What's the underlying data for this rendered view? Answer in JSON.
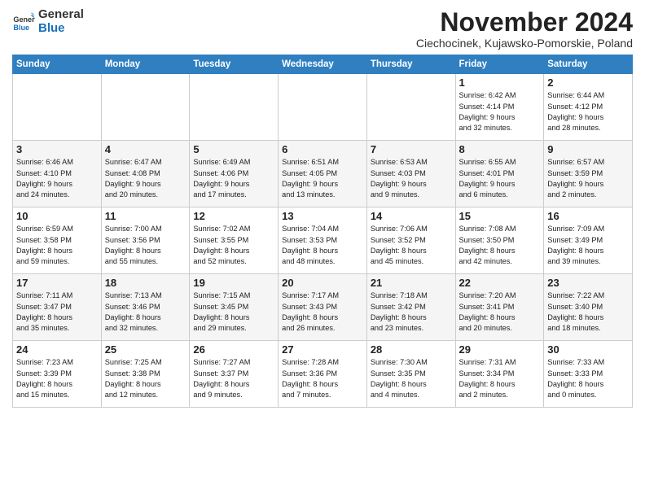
{
  "logo": {
    "line1": "General",
    "line2": "Blue"
  },
  "title": "November 2024",
  "location": "Ciechocinek, Kujawsko-Pomorskie, Poland",
  "headers": [
    "Sunday",
    "Monday",
    "Tuesday",
    "Wednesday",
    "Thursday",
    "Friday",
    "Saturday"
  ],
  "weeks": [
    [
      {
        "day": "",
        "info": ""
      },
      {
        "day": "",
        "info": ""
      },
      {
        "day": "",
        "info": ""
      },
      {
        "day": "",
        "info": ""
      },
      {
        "day": "",
        "info": ""
      },
      {
        "day": "1",
        "info": "Sunrise: 6:42 AM\nSunset: 4:14 PM\nDaylight: 9 hours\nand 32 minutes."
      },
      {
        "day": "2",
        "info": "Sunrise: 6:44 AM\nSunset: 4:12 PM\nDaylight: 9 hours\nand 28 minutes."
      }
    ],
    [
      {
        "day": "3",
        "info": "Sunrise: 6:46 AM\nSunset: 4:10 PM\nDaylight: 9 hours\nand 24 minutes."
      },
      {
        "day": "4",
        "info": "Sunrise: 6:47 AM\nSunset: 4:08 PM\nDaylight: 9 hours\nand 20 minutes."
      },
      {
        "day": "5",
        "info": "Sunrise: 6:49 AM\nSunset: 4:06 PM\nDaylight: 9 hours\nand 17 minutes."
      },
      {
        "day": "6",
        "info": "Sunrise: 6:51 AM\nSunset: 4:05 PM\nDaylight: 9 hours\nand 13 minutes."
      },
      {
        "day": "7",
        "info": "Sunrise: 6:53 AM\nSunset: 4:03 PM\nDaylight: 9 hours\nand 9 minutes."
      },
      {
        "day": "8",
        "info": "Sunrise: 6:55 AM\nSunset: 4:01 PM\nDaylight: 9 hours\nand 6 minutes."
      },
      {
        "day": "9",
        "info": "Sunrise: 6:57 AM\nSunset: 3:59 PM\nDaylight: 9 hours\nand 2 minutes."
      }
    ],
    [
      {
        "day": "10",
        "info": "Sunrise: 6:59 AM\nSunset: 3:58 PM\nDaylight: 8 hours\nand 59 minutes."
      },
      {
        "day": "11",
        "info": "Sunrise: 7:00 AM\nSunset: 3:56 PM\nDaylight: 8 hours\nand 55 minutes."
      },
      {
        "day": "12",
        "info": "Sunrise: 7:02 AM\nSunset: 3:55 PM\nDaylight: 8 hours\nand 52 minutes."
      },
      {
        "day": "13",
        "info": "Sunrise: 7:04 AM\nSunset: 3:53 PM\nDaylight: 8 hours\nand 48 minutes."
      },
      {
        "day": "14",
        "info": "Sunrise: 7:06 AM\nSunset: 3:52 PM\nDaylight: 8 hours\nand 45 minutes."
      },
      {
        "day": "15",
        "info": "Sunrise: 7:08 AM\nSunset: 3:50 PM\nDaylight: 8 hours\nand 42 minutes."
      },
      {
        "day": "16",
        "info": "Sunrise: 7:09 AM\nSunset: 3:49 PM\nDaylight: 8 hours\nand 39 minutes."
      }
    ],
    [
      {
        "day": "17",
        "info": "Sunrise: 7:11 AM\nSunset: 3:47 PM\nDaylight: 8 hours\nand 35 minutes."
      },
      {
        "day": "18",
        "info": "Sunrise: 7:13 AM\nSunset: 3:46 PM\nDaylight: 8 hours\nand 32 minutes."
      },
      {
        "day": "19",
        "info": "Sunrise: 7:15 AM\nSunset: 3:45 PM\nDaylight: 8 hours\nand 29 minutes."
      },
      {
        "day": "20",
        "info": "Sunrise: 7:17 AM\nSunset: 3:43 PM\nDaylight: 8 hours\nand 26 minutes."
      },
      {
        "day": "21",
        "info": "Sunrise: 7:18 AM\nSunset: 3:42 PM\nDaylight: 8 hours\nand 23 minutes."
      },
      {
        "day": "22",
        "info": "Sunrise: 7:20 AM\nSunset: 3:41 PM\nDaylight: 8 hours\nand 20 minutes."
      },
      {
        "day": "23",
        "info": "Sunrise: 7:22 AM\nSunset: 3:40 PM\nDaylight: 8 hours\nand 18 minutes."
      }
    ],
    [
      {
        "day": "24",
        "info": "Sunrise: 7:23 AM\nSunset: 3:39 PM\nDaylight: 8 hours\nand 15 minutes."
      },
      {
        "day": "25",
        "info": "Sunrise: 7:25 AM\nSunset: 3:38 PM\nDaylight: 8 hours\nand 12 minutes."
      },
      {
        "day": "26",
        "info": "Sunrise: 7:27 AM\nSunset: 3:37 PM\nDaylight: 8 hours\nand 9 minutes."
      },
      {
        "day": "27",
        "info": "Sunrise: 7:28 AM\nSunset: 3:36 PM\nDaylight: 8 hours\nand 7 minutes."
      },
      {
        "day": "28",
        "info": "Sunrise: 7:30 AM\nSunset: 3:35 PM\nDaylight: 8 hours\nand 4 minutes."
      },
      {
        "day": "29",
        "info": "Sunrise: 7:31 AM\nSunset: 3:34 PM\nDaylight: 8 hours\nand 2 minutes."
      },
      {
        "day": "30",
        "info": "Sunrise: 7:33 AM\nSunset: 3:33 PM\nDaylight: 8 hours\nand 0 minutes."
      }
    ]
  ]
}
